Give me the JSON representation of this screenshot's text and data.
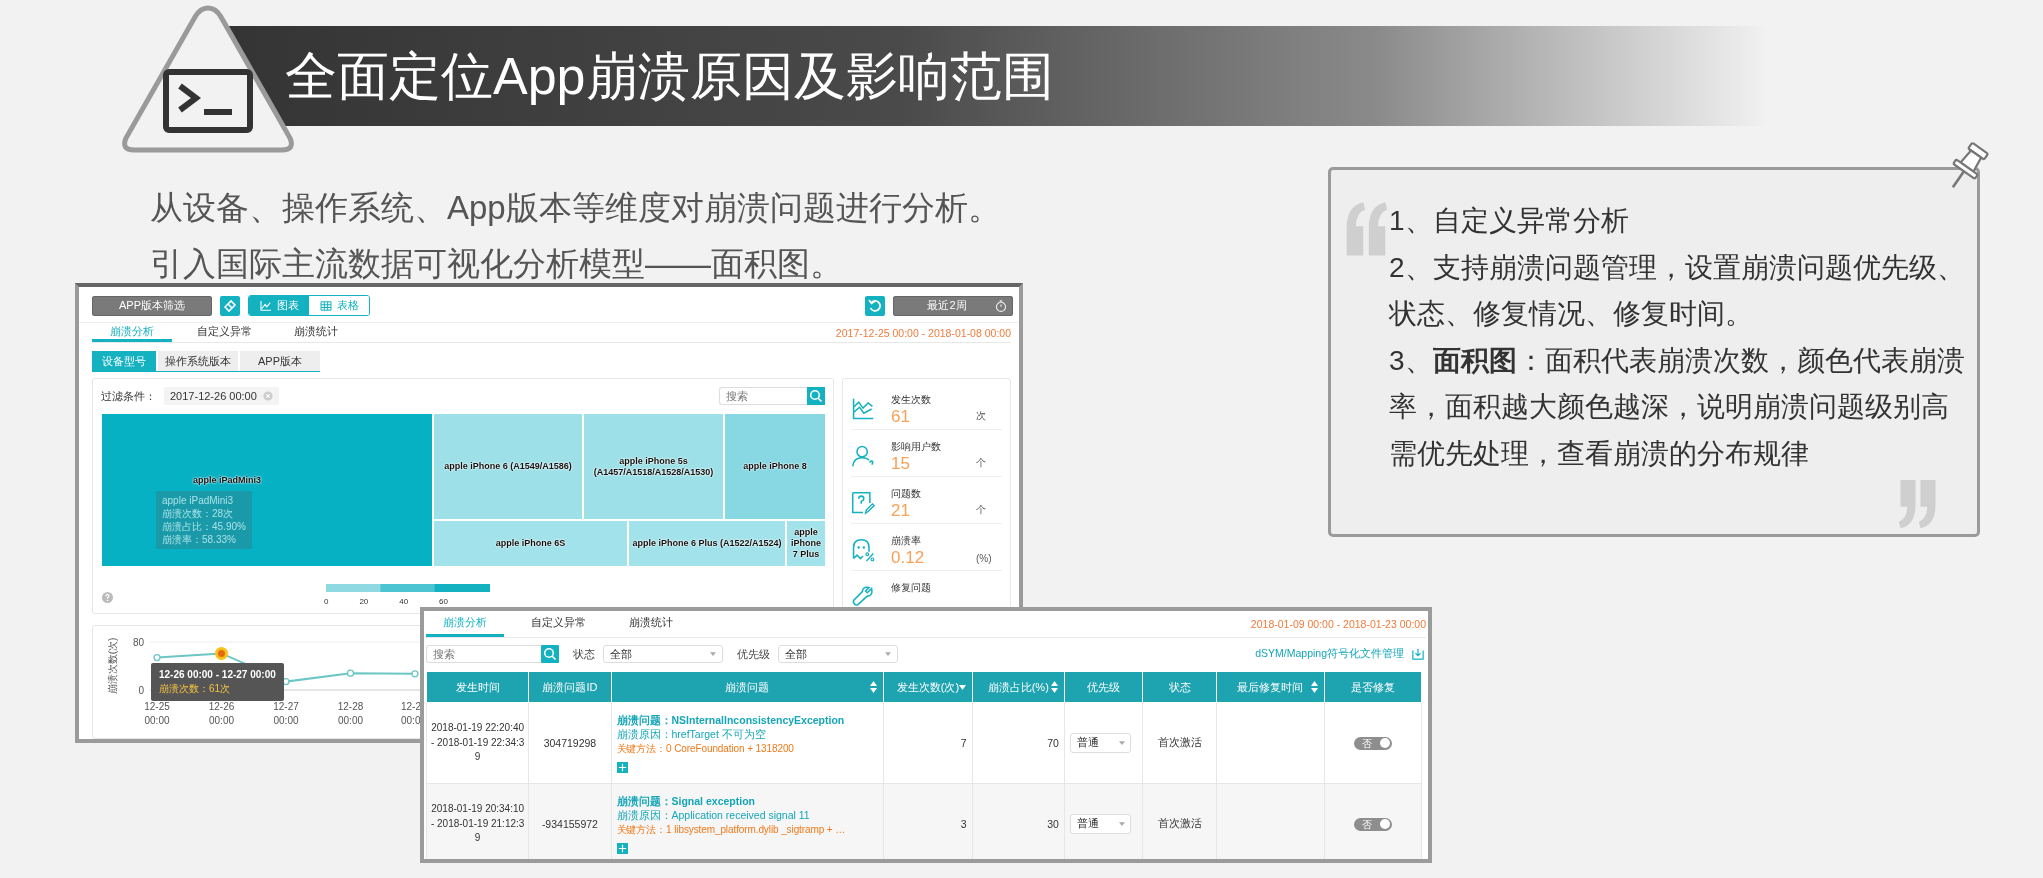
{
  "header": {
    "title": "全面定位App崩溃原因及影响范围"
  },
  "intro": [
    "从设备、操作系统、App版本等维度对崩溃问题进行分析。",
    "引入国际主流数据可视化分析模型——面积图。"
  ],
  "note": {
    "items": [
      "1、自定义异常分析",
      "2、支持崩溃问题管理，设置崩溃问题优先级、状态、修复情况、修复时间。",
      "3、**面积图**：面积代表崩溃次数，颜色代表崩溃率，面积越大颜色越深，说明崩溃问题级别高需优先处理，查看崩溃的分布规律"
    ]
  },
  "dashboard": {
    "filter_button": "APP版本筛选",
    "view_toggle": [
      {
        "label": "图表",
        "kind": "chart",
        "selected": true
      },
      {
        "label": "表格",
        "kind": "table",
        "selected": false
      }
    ],
    "range_button": "最近2周",
    "tabs": [
      {
        "label": "崩溃分析",
        "selected": true
      },
      {
        "label": "自定义异常",
        "selected": false
      },
      {
        "label": "崩溃统计",
        "selected": false
      }
    ],
    "date_range": "2017-12-25 00:00 - 2018-01-08 00:00",
    "subtabs": [
      {
        "label": "设备型号",
        "selected": true
      },
      {
        "label": "操作系统版本",
        "selected": false
      },
      {
        "label": "APP版本",
        "selected": false
      }
    ],
    "filter": {
      "label": "过滤条件：",
      "value": "2017-12-26 00:00"
    },
    "search": {
      "placeholder": "搜索"
    },
    "treemap": {
      "cells": [
        {
          "label": "apple iPadMini3",
          "color": "#05b1c3"
        },
        {
          "label": "apple iPhone 6 (A1549/A1586)",
          "color": "#9ee0e8"
        },
        {
          "label": "apple iPhone 5s (A1457/A1518/A1528/A1530)",
          "color": "#9ee0e8"
        },
        {
          "label": "apple iPhone 8",
          "color": "#88d8e3"
        },
        {
          "label": "apple iPhone 6S",
          "color": "#a2e2ea"
        },
        {
          "label": "apple iPhone 6 Plus (A1522/A1524)",
          "color": "#a2e2ea"
        },
        {
          "label": "apple iPhone 7 Plus",
          "color": "#a2e2ea"
        }
      ],
      "tooltip": [
        "apple iPadMini3",
        "崩溃次数：28次",
        "崩溃占比：45.90%",
        "崩溃率：58.33%"
      ],
      "legend": [
        "0",
        "20",
        "40",
        "60"
      ]
    },
    "stats": [
      {
        "kind": "occurrences",
        "label": "发生次数",
        "value": "61",
        "unit": "次"
      },
      {
        "kind": "users",
        "label": "影响用户数",
        "value": "15",
        "unit": "个"
      },
      {
        "kind": "issues",
        "label": "问题数",
        "value": "21",
        "unit": "个"
      },
      {
        "kind": "rate",
        "label": "崩溃率",
        "value": "0.12",
        "unit": "(%)"
      },
      {
        "kind": "fixed",
        "label": "修复问题"
      }
    ],
    "trend": {
      "chart_data": {
        "type": "line",
        "ylabel": "崩溃次数(次)",
        "categories": [
          "12-25 00:00",
          "12-26 00:00",
          "12-27 00:00",
          "12-28 00:00",
          "12-2 00:0"
        ],
        "series": [
          {
            "color": "#6cc6c4",
            "marker": true,
            "values": [
              54,
              61,
              14,
              28,
              27
            ]
          }
        ],
        "ylim": [
          0,
          80
        ],
        "yticks": [
          0,
          80
        ]
      },
      "highlighted": [
        false,
        true,
        false,
        false,
        false
      ],
      "tooltip": {
        "title": "12-26 00:00 - 12-27 00:00",
        "text": "崩溃次数：61次"
      }
    }
  },
  "detail": {
    "tabs": [
      {
        "label": "崩溃分析",
        "selected": true
      },
      {
        "label": "自定义异常",
        "selected": false
      },
      {
        "label": "崩溃统计",
        "selected": false
      }
    ],
    "date_range": "2018-01-09 00:00 - 2018-01-23 00:00",
    "search": {
      "placeholder": "搜索"
    },
    "filters": [
      {
        "label": "状态",
        "value": "全部"
      },
      {
        "label": "优先级",
        "value": "全部"
      }
    ],
    "file_link": "dSYM/Mapping符号化文件管理",
    "columns": [
      {
        "label": "发生时间",
        "sortable": false,
        "descending": false
      },
      {
        "label": "崩溃问题ID",
        "sortable": false,
        "descending": false
      },
      {
        "label": "崩溃问题",
        "sortable": true,
        "descending": false
      },
      {
        "label": "发生次数(次)",
        "sortable": false,
        "descending": true
      },
      {
        "label": "崩溃占比(%)",
        "sortable": true,
        "descending": false
      },
      {
        "label": "优先级",
        "sortable": false,
        "descending": false
      },
      {
        "label": "状态",
        "sortable": false,
        "descending": false
      },
      {
        "label": "最后修复时间",
        "sortable": true,
        "descending": false
      },
      {
        "label": "是否修复",
        "sortable": false,
        "descending": false
      }
    ],
    "rows": [
      {
        "time": "2018-01-19 22:20:40 - 2018-01-19 22:34:39",
        "id": "304719298",
        "issue": "崩溃问题：NSInternalInconsistencyException",
        "reason": "崩溃原因：hrefTarget 不可为空",
        "method": "关键方法：0 CoreFoundation + 1318200",
        "count": "7",
        "ratio": "70",
        "priority": "普通",
        "status": "首次激活",
        "fixed": {
          "label": "否",
          "on": false
        }
      },
      {
        "time": "2018-01-19 20:34:10 - 2018-01-19 21:12:39",
        "id": "-934155972",
        "issue": "崩溃问题：Signal exception",
        "reason": "崩溃原因：Application received signal 11",
        "method": "关键方法：1 libsystem_platform.dylib _sigtramp + …",
        "count": "3",
        "ratio": "30",
        "priority": "普通",
        "status": "首次激活",
        "fixed": {
          "label": "否",
          "on": false
        }
      }
    ]
  }
}
